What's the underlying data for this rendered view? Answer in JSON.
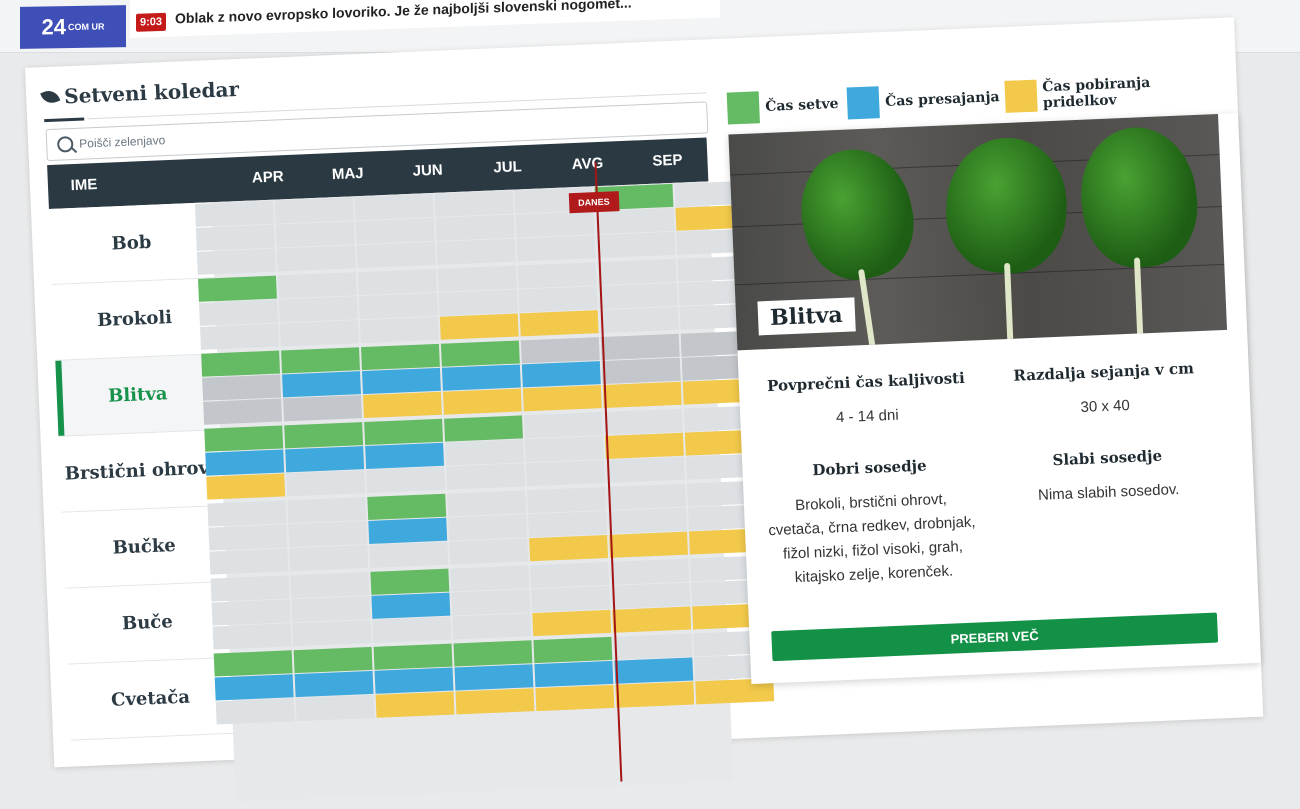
{
  "header": {
    "logo_text": "24",
    "logo_suffix": "COM UR",
    "ticker_time": "9:03",
    "ticker_text": "Oblak z novo evropsko lovoriko. Je že najboljši slovenski nogomet..."
  },
  "calendar": {
    "title": "Setveni koledar",
    "search_placeholder": "Poišči zelenjavo",
    "name_header": "IME",
    "months": [
      "APR",
      "MAJ",
      "JUN",
      "JUL",
      "AVG",
      "SEP"
    ],
    "today_label": "DANES",
    "rows": [
      {
        "name": "Bob",
        "active": false,
        "bars": [
          [],
          [],
          []
        ]
      },
      {
        "name": "Brokoli",
        "active": false,
        "bars": [
          [],
          [],
          []
        ]
      },
      {
        "name": "Blitva",
        "active": true,
        "bars": [
          [],
          [],
          []
        ]
      },
      {
        "name": "Brstični ohrovt",
        "active": false,
        "bars": [
          [],
          [],
          []
        ]
      },
      {
        "name": "Bučke",
        "active": false,
        "bars": [
          [],
          [],
          []
        ]
      },
      {
        "name": "Buče",
        "active": false,
        "bars": [
          [],
          [],
          []
        ]
      },
      {
        "name": "Cvetača",
        "active": false,
        "bars": [
          [],
          [],
          []
        ]
      }
    ]
  },
  "legend": [
    {
      "label": "Čas setve",
      "color": "#64bb64"
    },
    {
      "label": "Čas presajanja",
      "color": "#3fa8dc"
    },
    {
      "label": "Čas pobiranja pridelkov",
      "color": "#f2c94a"
    }
  ],
  "card": {
    "name": "Blitva",
    "germination_label": "Povprečni čas kaljivosti",
    "germination_value": "4 - 14 dni",
    "spacing_label": "Razdalja sejanja v cm",
    "spacing_value": "30 x 40",
    "good_neighbors_label": "Dobri sosedje",
    "good_neighbors_value": "Brokoli, brstični ohrovt, cvetača, črna redkev, drobnjak, fižol nizki, fižol visoki, grah, kitajsko zelje, korenček.",
    "bad_neighbors_label": "Slabi sosedje",
    "bad_neighbors_value": "Nima slabih sosedov.",
    "cta_label": "PREBERI VEČ"
  },
  "colors": {
    "sowing": "#64bb64",
    "transplant": "#3fa8dc",
    "harvest": "#f2c94a",
    "empty": "#dde1e4",
    "grey": "#c3c7cb",
    "accent": "#16924a",
    "header_bg": "#2b3a42"
  }
}
